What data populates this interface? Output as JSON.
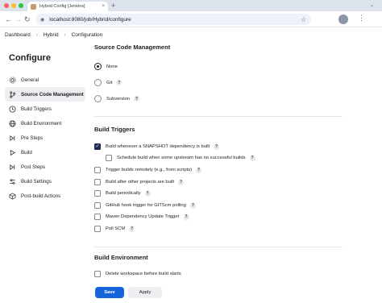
{
  "browser": {
    "tab_title": "Hybrid Config [Jenkins]",
    "tab_close": "×",
    "new_tab": "+",
    "url": "localhost:8080/job/Hybrid/configure",
    "icons": [
      "back-icon",
      "forward-icon",
      "reload-icon",
      "site-info-icon",
      "star-icon",
      "profile-avatar",
      "menu-icon"
    ],
    "traffic_colors": [
      "#ff5f57",
      "#febc2e",
      "#28c840"
    ]
  },
  "breadcrumb": [
    "Dashboard",
    "Hybrid",
    "Configuration"
  ],
  "sidebar": {
    "title": "Configure",
    "items": [
      {
        "label": "General",
        "icon": "gear-icon",
        "active": false
      },
      {
        "label": "Source Code Management",
        "icon": "branch-icon",
        "active": true
      },
      {
        "label": "Build Triggers",
        "icon": "clock-icon",
        "active": false
      },
      {
        "label": "Build Environment",
        "icon": "globe-icon",
        "active": false
      },
      {
        "label": "Pre Steps",
        "icon": "forward-step-icon",
        "active": false
      },
      {
        "label": "Build",
        "icon": "play-icon",
        "active": false
      },
      {
        "label": "Post Steps",
        "icon": "forward-step-icon",
        "active": false
      },
      {
        "label": "Build Settings",
        "icon": "settings-icon",
        "active": false
      },
      {
        "label": "Post-build Actions",
        "icon": "cube-icon",
        "active": false
      }
    ]
  },
  "scm": {
    "title": "Source Code Management",
    "options": [
      {
        "label": "None",
        "selected": true,
        "help": false
      },
      {
        "label": "Git",
        "selected": false,
        "help": true
      },
      {
        "label": "Subversion",
        "selected": false,
        "help": true
      }
    ]
  },
  "triggers": {
    "title": "Build Triggers",
    "options": [
      {
        "label": "Build whenever a SNAPSHOT dependency is built",
        "checked": true,
        "indent": false
      },
      {
        "label": "Schedule build when some upstream has no successful builds",
        "checked": false,
        "indent": true
      },
      {
        "label": "Trigger builds remotely (e.g., from scripts)",
        "checked": false,
        "indent": false
      },
      {
        "label": "Build after other projects are built",
        "checked": false,
        "indent": false
      },
      {
        "label": "Build periodically",
        "checked": false,
        "indent": false
      },
      {
        "label": "GitHub hook trigger for GITScm polling",
        "checked": false,
        "indent": false
      },
      {
        "label": "Maven Dependency Update Trigger",
        "checked": false,
        "indent": false
      },
      {
        "label": "Poll SCM",
        "checked": false,
        "indent": false
      }
    ]
  },
  "environment": {
    "title": "Build Environment",
    "options": [
      {
        "label": "Delete workspace before build starts",
        "checked": false
      }
    ]
  },
  "help_glyph": "?",
  "buttons": {
    "save": "Save",
    "apply": "Apply"
  },
  "colors": {
    "primary": "#1565d8",
    "checked": "#1f2b4d",
    "active_bg": "#eceef1"
  }
}
